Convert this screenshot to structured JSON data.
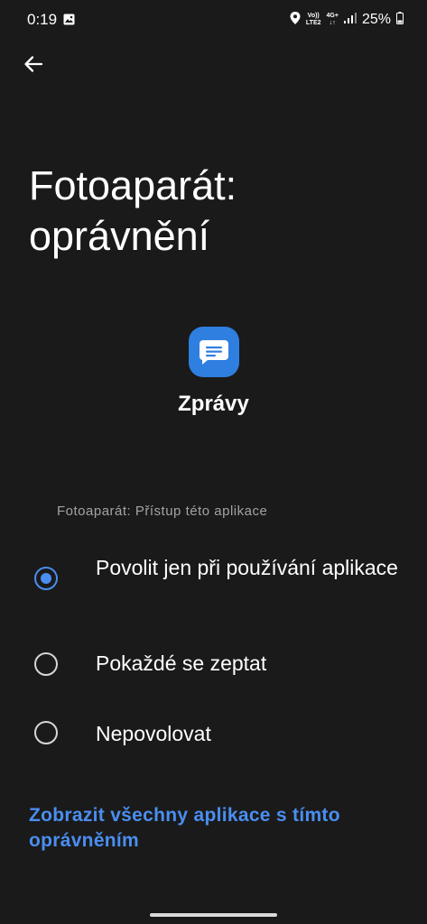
{
  "status_bar": {
    "time": "0:19",
    "network_top": "Vo))",
    "network_bottom": "LTE2",
    "data_top": "4G+",
    "data_bottom": "↓↑",
    "battery": "25%"
  },
  "header": {
    "back_icon": "arrow-left-icon",
    "title": "Fotoaparát: oprávnění"
  },
  "app": {
    "icon": "messages-icon",
    "name": "Zprávy",
    "icon_color": "#2f7fe0"
  },
  "permission": {
    "section_label": "Fotoaparát: Přístup této aplikace",
    "options": [
      {
        "label": "Povolit jen při používání aplikace",
        "selected": true
      },
      {
        "label": "Pokaždé se zeptat",
        "selected": false
      },
      {
        "label": "Nepovolovat",
        "selected": false
      }
    ]
  },
  "footer": {
    "link": "Zobrazit všechny aplikace s tímto oprávněním"
  },
  "colors": {
    "background": "#1a1a1a",
    "accent": "#4a8ef0",
    "secondary_text": "#a3a3a3"
  }
}
